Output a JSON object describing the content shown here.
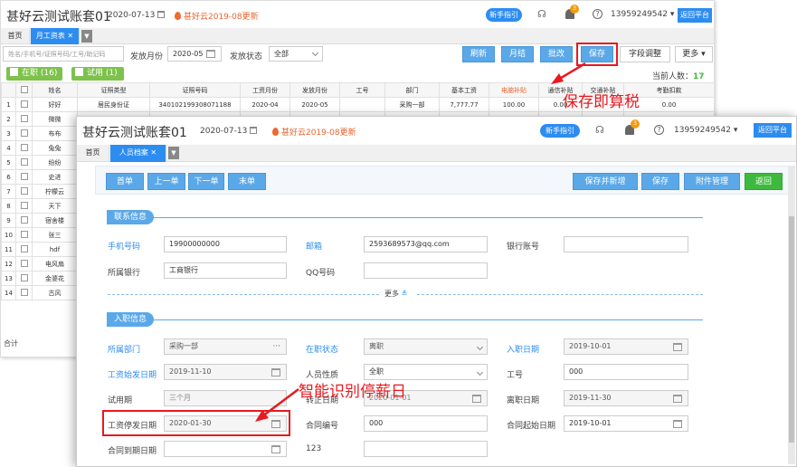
{
  "back": {
    "title": "甚好云测试账套01",
    "date": "2020-07-13",
    "update": "甚好云2019-08更新",
    "guide": "新手指引",
    "badge": "3",
    "help": "?",
    "phone": "13959249542",
    "platform": "返回平台",
    "tabs": [
      "首页",
      "月工资表"
    ],
    "tab_close": "✕",
    "tab_more": "▼",
    "search_placeholder": "姓名/手机号/证照号码/工号/助记码",
    "month_label": "发放月份",
    "month_value": "2020-05",
    "status_label": "发放状态",
    "status_value": "全部",
    "buttons": [
      "刷新",
      "月结",
      "批改",
      "保存",
      "字段调整",
      "更多"
    ],
    "filter_active": "在职 (16)",
    "filter_trial": "试用 (1)",
    "count_label": "当前人数：",
    "count_value": "17",
    "columns": [
      "姓名",
      "证照类型",
      "证照号码",
      "工资月份",
      "发放月份",
      "工号",
      "部门",
      "基本工资",
      "电脑补贴",
      "通信补贴",
      "交通补贴",
      "考勤扣款"
    ],
    "rows": [
      {
        "n": "1",
        "name": "好好",
        "idtype": "居民身份证",
        "id": "340102199308071188",
        "wm": "2020-04",
        "pm": "2020-05",
        "no": "",
        "dept": "采购一部",
        "base": "7,777.77",
        "pc": "100.00",
        "phone": "0.00",
        "trans": "",
        "att": "0.00"
      },
      {
        "n": "2",
        "name": "微微"
      },
      {
        "n": "3",
        "name": "布布"
      },
      {
        "n": "4",
        "name": "兔兔"
      },
      {
        "n": "5",
        "name": "纷纷"
      },
      {
        "n": "6",
        "name": "史进"
      },
      {
        "n": "7",
        "name": "柠檬云"
      },
      {
        "n": "8",
        "name": "天下"
      },
      {
        "n": "9",
        "name": "宿舍楼"
      },
      {
        "n": "10",
        "name": "张三"
      },
      {
        "n": "11",
        "name": "hdf"
      },
      {
        "n": "12",
        "name": "电风扇"
      },
      {
        "n": "13",
        "name": "金婆花"
      },
      {
        "n": "14",
        "name": "古风"
      }
    ],
    "total_label": "合计"
  },
  "front": {
    "title": "甚好云测试账套01",
    "date": "2020-07-13",
    "update": "甚好云2019-08更新",
    "guide": "新手指引",
    "badge": "3",
    "help": "?",
    "phone": "13959249542",
    "platform": "返回平台",
    "tabs": [
      "首页",
      "人员档案"
    ],
    "tab_close": "✕",
    "tab_more": "▼",
    "nav_buttons": [
      "首单",
      "上一单",
      "下一单",
      "末单"
    ],
    "action_buttons": [
      "保存并新增",
      "保存",
      "附件管理",
      "返回"
    ],
    "contact_section": "联系信息",
    "mobile_label": "手机号码",
    "mobile_value": "19900000000",
    "email_label": "邮箱",
    "email_value": "2593689573@qq.com",
    "bank_acct_label": "银行账号",
    "bank_label": "所属银行",
    "bank_value": "工商银行",
    "qq_label": "QQ号码",
    "more": "更多",
    "entry_section": "入职信息",
    "dept_label": "所属部门",
    "dept_value": "采购一部",
    "status_label": "在职状态",
    "status_value": "离职",
    "join_label": "入职日期",
    "join_value": "2019-10-01",
    "paystart_label": "工资始发日期",
    "paystart_value": "2019-11-10",
    "nature_label": "人员性质",
    "nature_value": "全职",
    "no_label": "工号",
    "no_value": "000",
    "trial_label": "试用期",
    "trial_value": "三个月",
    "regular_label": "转正日期",
    "regular_value": "2020-01-01",
    "leave_label": "离职日期",
    "leave_value": "2019-11-30",
    "paystop_label": "工资停发日期",
    "paystop_value": "2020-01-30",
    "contract_no_label": "合同编号",
    "contract_no_value": "000",
    "contract_start_label": "合同起始日期",
    "contract_start_value": "2019-10-01",
    "contract_end_label": "合同到期日期",
    "custom_label": "123"
  },
  "annotations": {
    "save_tax": "保存即算税",
    "smart_stop": "智能识别停薪日"
  },
  "colors": {
    "accent": "#2d8cf0",
    "highlight": "#e8191f",
    "green": "#3db93d"
  }
}
